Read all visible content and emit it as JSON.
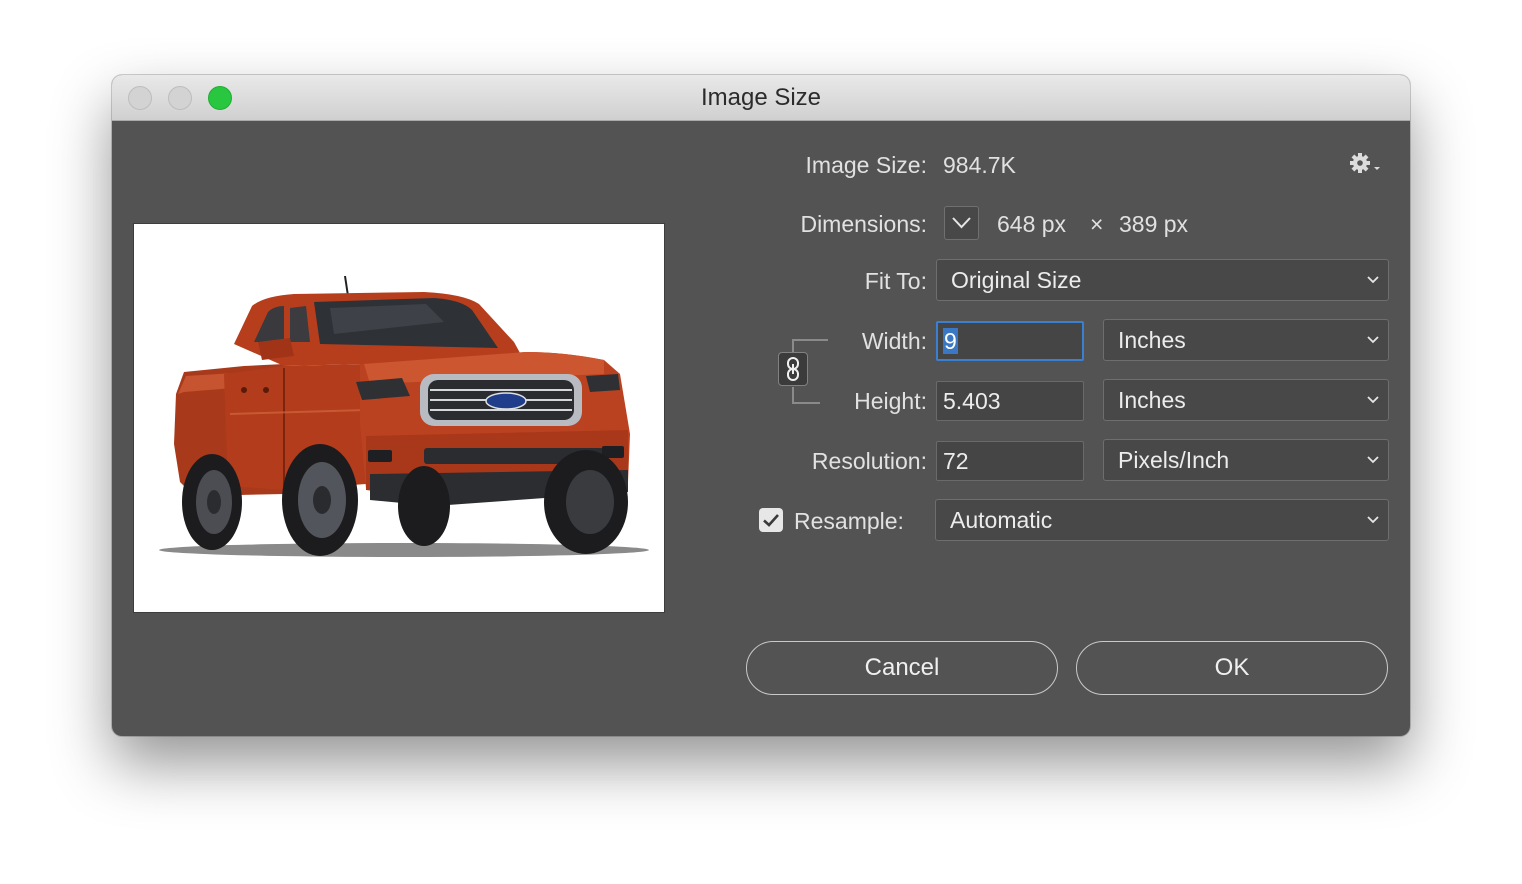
{
  "window": {
    "title": "Image Size"
  },
  "info": {
    "image_size_label": "Image Size:",
    "image_size_value": "984.7K",
    "dimensions_label": "Dimensions:",
    "dimensions_width": "648 px",
    "dimensions_sep": "×",
    "dimensions_height": "389 px"
  },
  "fit_to": {
    "label": "Fit To:",
    "value": "Original Size"
  },
  "width": {
    "label": "Width:",
    "value": "9",
    "unit": "Inches"
  },
  "height": {
    "label": "Height:",
    "value": "5.403",
    "unit": "Inches"
  },
  "resolution": {
    "label": "Resolution:",
    "value": "72",
    "unit": "Pixels/Inch"
  },
  "resample": {
    "label": "Resample:",
    "checked": true,
    "value": "Automatic"
  },
  "buttons": {
    "cancel": "Cancel",
    "ok": "OK"
  },
  "colors": {
    "dialog_bg": "#535353",
    "selection": "#3a78c4",
    "focus_ring": "#3b7fd1",
    "zoom_button": "#29c740",
    "truck_body": "#b8401f"
  },
  "icons": {
    "gear": "gear-icon",
    "chain": "chain-link-icon",
    "chevron": "chevron-down-icon",
    "check": "checkmark-icon"
  }
}
